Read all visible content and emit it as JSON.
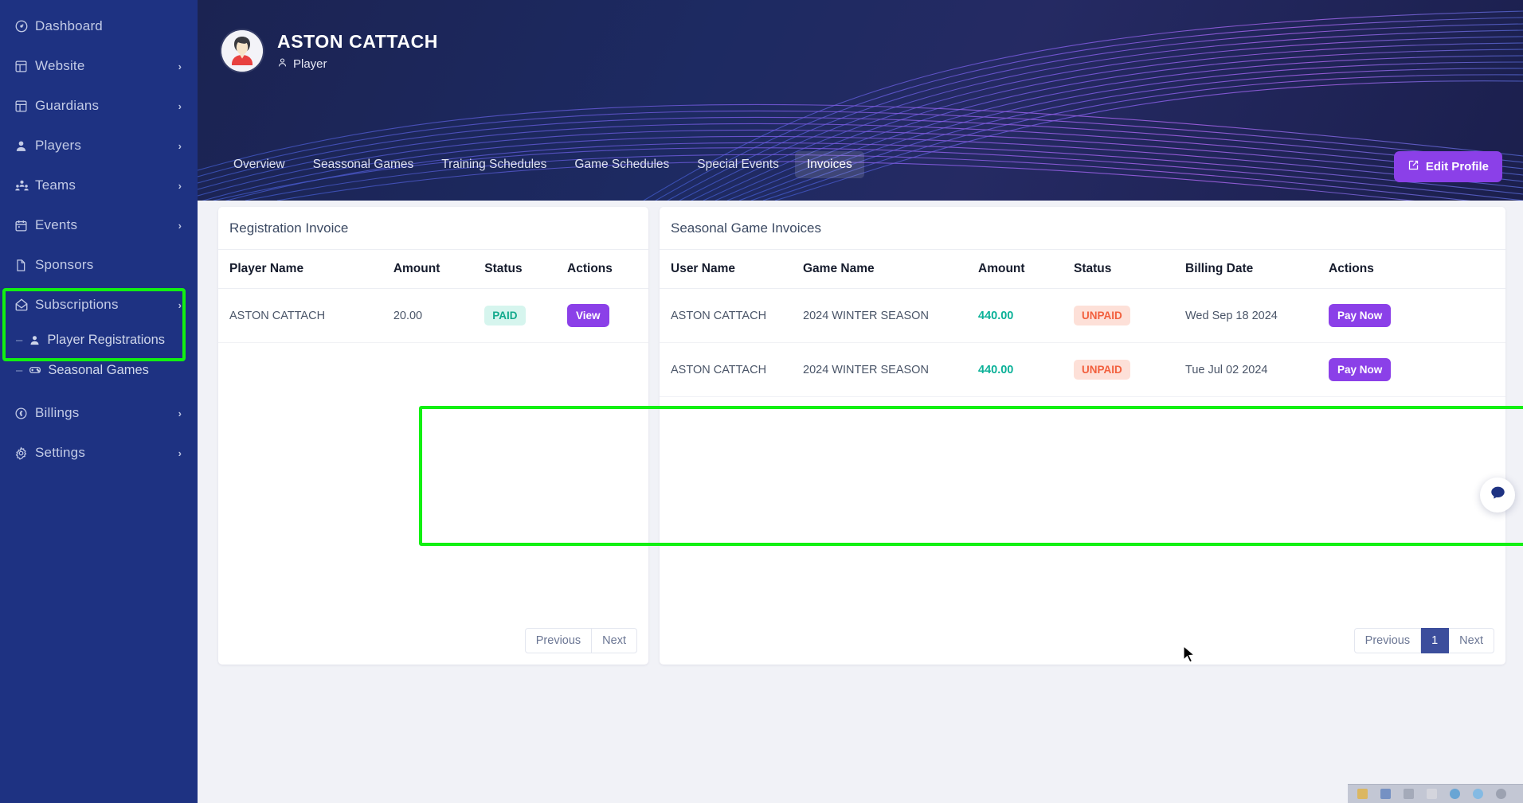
{
  "sidebar": {
    "items": [
      {
        "label": "Dashboard",
        "icon": "gauge-icon",
        "chevron": ""
      },
      {
        "label": "Website",
        "icon": "layout-icon",
        "chevron": "›"
      },
      {
        "label": "Guardians",
        "icon": "layout-icon",
        "chevron": "›"
      },
      {
        "label": "Players",
        "icon": "user-icon",
        "chevron": "›"
      },
      {
        "label": "Teams",
        "icon": "users-group-icon",
        "chevron": "›"
      },
      {
        "label": "Events",
        "icon": "calendar-icon",
        "chevron": "›"
      },
      {
        "label": "Sponsors",
        "icon": "file-icon",
        "chevron": ""
      },
      {
        "label": "Subscriptions",
        "icon": "envelope-icon",
        "chevron": "›"
      }
    ],
    "subitems": [
      {
        "label": "Player Registrations",
        "icon": "user-icon",
        "dash": "–"
      },
      {
        "label": "Seasonal Games",
        "icon": "gamepad-icon",
        "dash": "–"
      }
    ],
    "items_after": [
      {
        "label": "Billings",
        "icon": "coin-icon",
        "chevron": "›"
      },
      {
        "label": "Settings",
        "icon": "gear-icon",
        "chevron": "›"
      }
    ]
  },
  "header": {
    "profile_name": "ASTON CATTACH",
    "profile_role": "Player",
    "role_icon": "user-icon",
    "edit_button": "Edit Profile",
    "edit_icon": "edit-square-icon"
  },
  "tabs": [
    {
      "label": "Overview",
      "active": false
    },
    {
      "label": "Seassonal Games",
      "active": false
    },
    {
      "label": "Training Schedules",
      "active": false
    },
    {
      "label": "Game Schedules",
      "active": false
    },
    {
      "label": "Special Events",
      "active": false
    },
    {
      "label": "Invoices",
      "active": true
    }
  ],
  "registration_card": {
    "title": "Registration Invoice",
    "columns": [
      "Player Name",
      "Amount",
      "Status",
      "Actions"
    ],
    "rows": [
      {
        "player_name": "ASTON CATTACH",
        "amount": "20.00",
        "status": "PAID",
        "action": "View"
      }
    ],
    "pager": {
      "previous": "Previous",
      "next": "Next",
      "pages": []
    }
  },
  "seasonal_card": {
    "title": "Seasonal Game Invoices",
    "columns": [
      "User Name",
      "Game Name",
      "Amount",
      "Status",
      "Billing Date",
      "Actions"
    ],
    "rows": [
      {
        "user_name": "ASTON CATTACH",
        "game_name": "2024 WINTER SEASON",
        "amount": "440.00",
        "status": "UNPAID",
        "billing_date": "Wed Sep 18 2024",
        "action": "Pay Now"
      },
      {
        "user_name": "ASTON CATTACH",
        "game_name": "2024 WINTER SEASON",
        "amount": "440.00",
        "status": "UNPAID",
        "billing_date": "Tue Jul 02 2024",
        "action": "Pay Now"
      }
    ],
    "pager": {
      "previous": "Previous",
      "next": "Next",
      "current_page": "1"
    }
  },
  "widgets": {
    "chat_icon": "chat-bubble-icon"
  },
  "colors": {
    "sidebar_bg": "#1e3282",
    "accent_purple": "#8b40e8",
    "highlight_green": "#12f012",
    "paid_text": "#12a98c",
    "paid_bg": "#d6f5ee",
    "unpaid_text": "#f2603e",
    "unpaid_bg": "#fde0d8",
    "amount_green": "#0bb198",
    "pager_active": "#3c4e9c"
  }
}
